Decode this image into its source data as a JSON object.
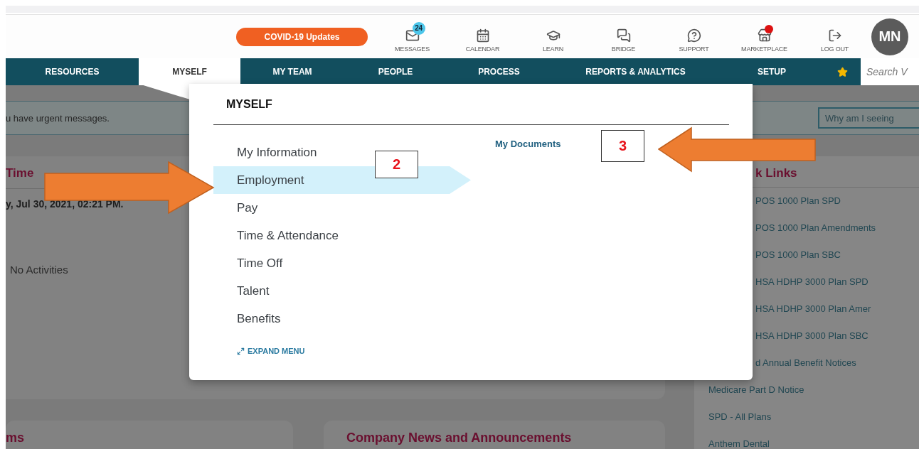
{
  "header": {
    "covid_button": "COVID-19 Updates",
    "icons": [
      {
        "kind": "messages",
        "label": "MESSAGES",
        "badge": "24"
      },
      {
        "kind": "calendar",
        "label": "CALENDAR"
      },
      {
        "kind": "learn",
        "label": "LEARN"
      },
      {
        "kind": "bridge",
        "label": "BRIDGE"
      },
      {
        "kind": "support",
        "label": "SUPPORT"
      },
      {
        "kind": "marketplace",
        "label": "MARKETPLACE",
        "alert": true
      },
      {
        "kind": "logout",
        "label": "LOG OUT"
      }
    ],
    "avatar": "MN"
  },
  "nav": {
    "tabs": [
      {
        "label": "RESOURCES",
        "selected": false
      },
      {
        "label": "MYSELF",
        "selected": true
      },
      {
        "label": "MY TEAM",
        "selected": false
      },
      {
        "label": "PEOPLE",
        "selected": false
      },
      {
        "label": "PROCESS",
        "selected": false
      },
      {
        "label": "REPORTS & ANALYTICS",
        "selected": false
      },
      {
        "label": "SETUP",
        "selected": false
      }
    ],
    "search": {
      "placeholder": "Search V"
    }
  },
  "alert": {
    "message": "u have urgent messages.",
    "button": "Why am I seeing"
  },
  "activity_card": {
    "title": "Time",
    "date": "y, Jul 30, 2021, 02:21 PM.",
    "empty_text": "No Activities"
  },
  "quick_links": {
    "title": "k Links",
    "items_beside_menu": [
      "POS 1000 Plan SPD",
      "POS 1000 Plan Amendments",
      "POS 1000 Plan SBC",
      "HSA HDHP 3000 Plan SPD",
      "HSA HDHP 3000 Plan Amer",
      "HSA HDHP 3000 Plan SBC",
      "d Annual Benefit Notices"
    ],
    "items": [
      "Medicare Part D Notice",
      "SPD - All Plans",
      "Anthem Dental"
    ]
  },
  "bottom_cards": [
    {
      "title": "ms"
    },
    {
      "title": "Company News and Announcements"
    }
  ],
  "menu": {
    "title": "MYSELF",
    "items": [
      {
        "label": "My Information",
        "selected": false
      },
      {
        "label": "Employment",
        "selected": true
      },
      {
        "label": "Pay",
        "selected": false
      },
      {
        "label": "Time & Attendance",
        "selected": false
      },
      {
        "label": "Time Off",
        "selected": false
      },
      {
        "label": "Talent",
        "selected": false
      },
      {
        "label": "Benefits",
        "selected": false
      }
    ],
    "submenu": [
      "My Documents"
    ],
    "expand": "EXPAND MENU"
  },
  "annotations": [
    {
      "number": "2",
      "kind": "right_arrow"
    },
    {
      "number": "3",
      "kind": "left_arrow"
    }
  ]
}
